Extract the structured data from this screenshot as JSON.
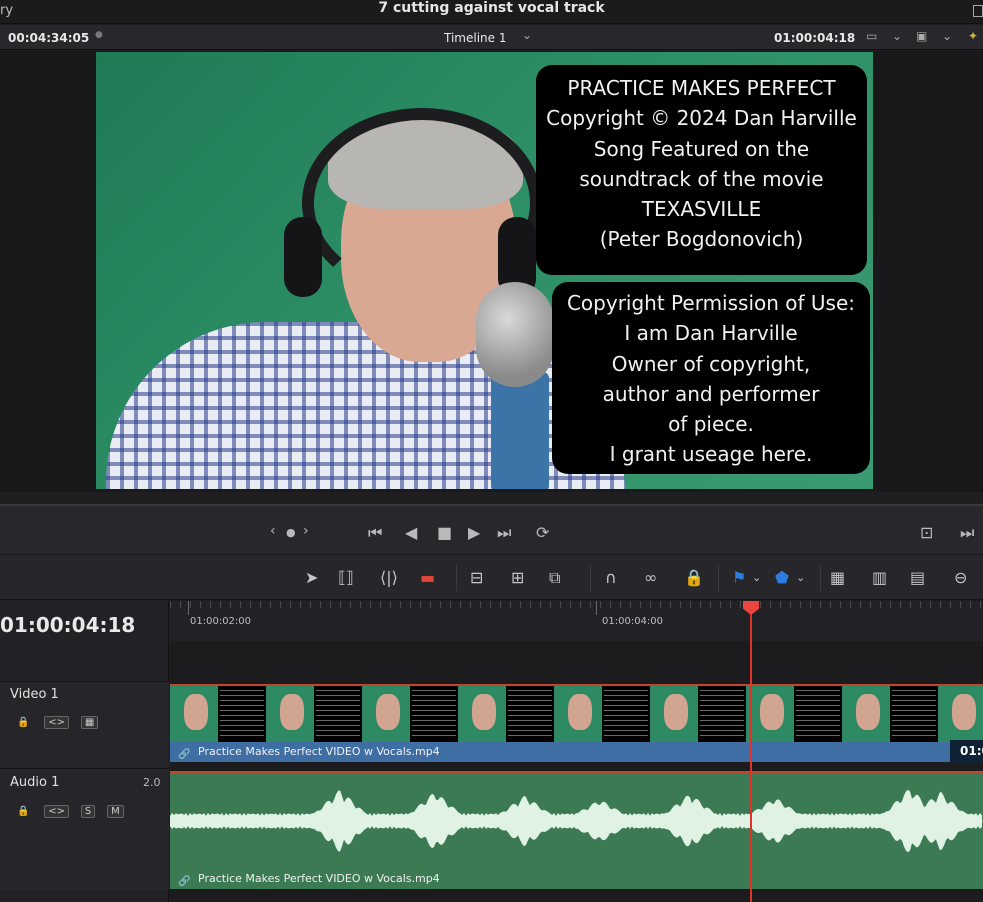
{
  "titlebar": {
    "left_fragment": "ry",
    "title": "7 cutting against vocal track"
  },
  "viewer_header": {
    "source_timecode": "00:04:34:05",
    "timeline_name": "Timeline 1",
    "record_timecode": "01:00:04:18"
  },
  "viewer": {
    "overlay_box_1": [
      "PRACTICE MAKES PERFECT",
      "Copyright © 2024 Dan Harville",
      "Song Featured on the",
      "soundtrack of the movie",
      "TEXASVILLE",
      "(Peter Bogdonovich)"
    ],
    "overlay_box_2": [
      "Copyright Permission of Use:",
      "I am Dan Harville",
      "Owner of copyright,",
      "author and performer",
      "of piece.",
      "I grant useage here."
    ]
  },
  "transport": {
    "icons": [
      "jog-left-icon",
      "jog-dot-icon",
      "jog-right-icon",
      "go-to-start-icon",
      "play-reverse-icon",
      "stop-icon",
      "play-icon",
      "go-to-end-icon",
      "loop-icon",
      "fullscreen-icon",
      "next-edit-icon"
    ]
  },
  "toolbar": {
    "icons": [
      "selection-tool-icon",
      "trim-edit-icon",
      "dynamic-trim-icon",
      "blade-tool-icon",
      "insert-clip-icon",
      "overwrite-clip-icon",
      "replace-clip-icon",
      "snapping-icon",
      "linked-selection-icon",
      "position-lock-icon",
      "flag-icon",
      "marker-icon",
      "zoom-full-icon",
      "zoom-detail-icon",
      "zoom-custom-icon",
      "zoom-out-icon"
    ]
  },
  "timeline": {
    "current_timecode": "01:00:04:18",
    "ruler_labels": [
      "01:00:02:00",
      "01:00:04:00"
    ],
    "tracks": {
      "video": {
        "name": "Video 1",
        "clip_name": "Practice Makes Perfect VIDEO w Vocals.mp4",
        "end_timecode": "01:0"
      },
      "audio": {
        "name": "Audio 1",
        "channels": "2.0",
        "clip_name": "Practice Makes Perfect VIDEO w Vocals.mp4",
        "solo": "S",
        "mute": "M"
      }
    }
  },
  "colors": {
    "playhead": "#e0322b",
    "video_clip": "#3e6ea3",
    "audio_clip": "#3c7a53",
    "green_screen": "#2d8f66"
  }
}
